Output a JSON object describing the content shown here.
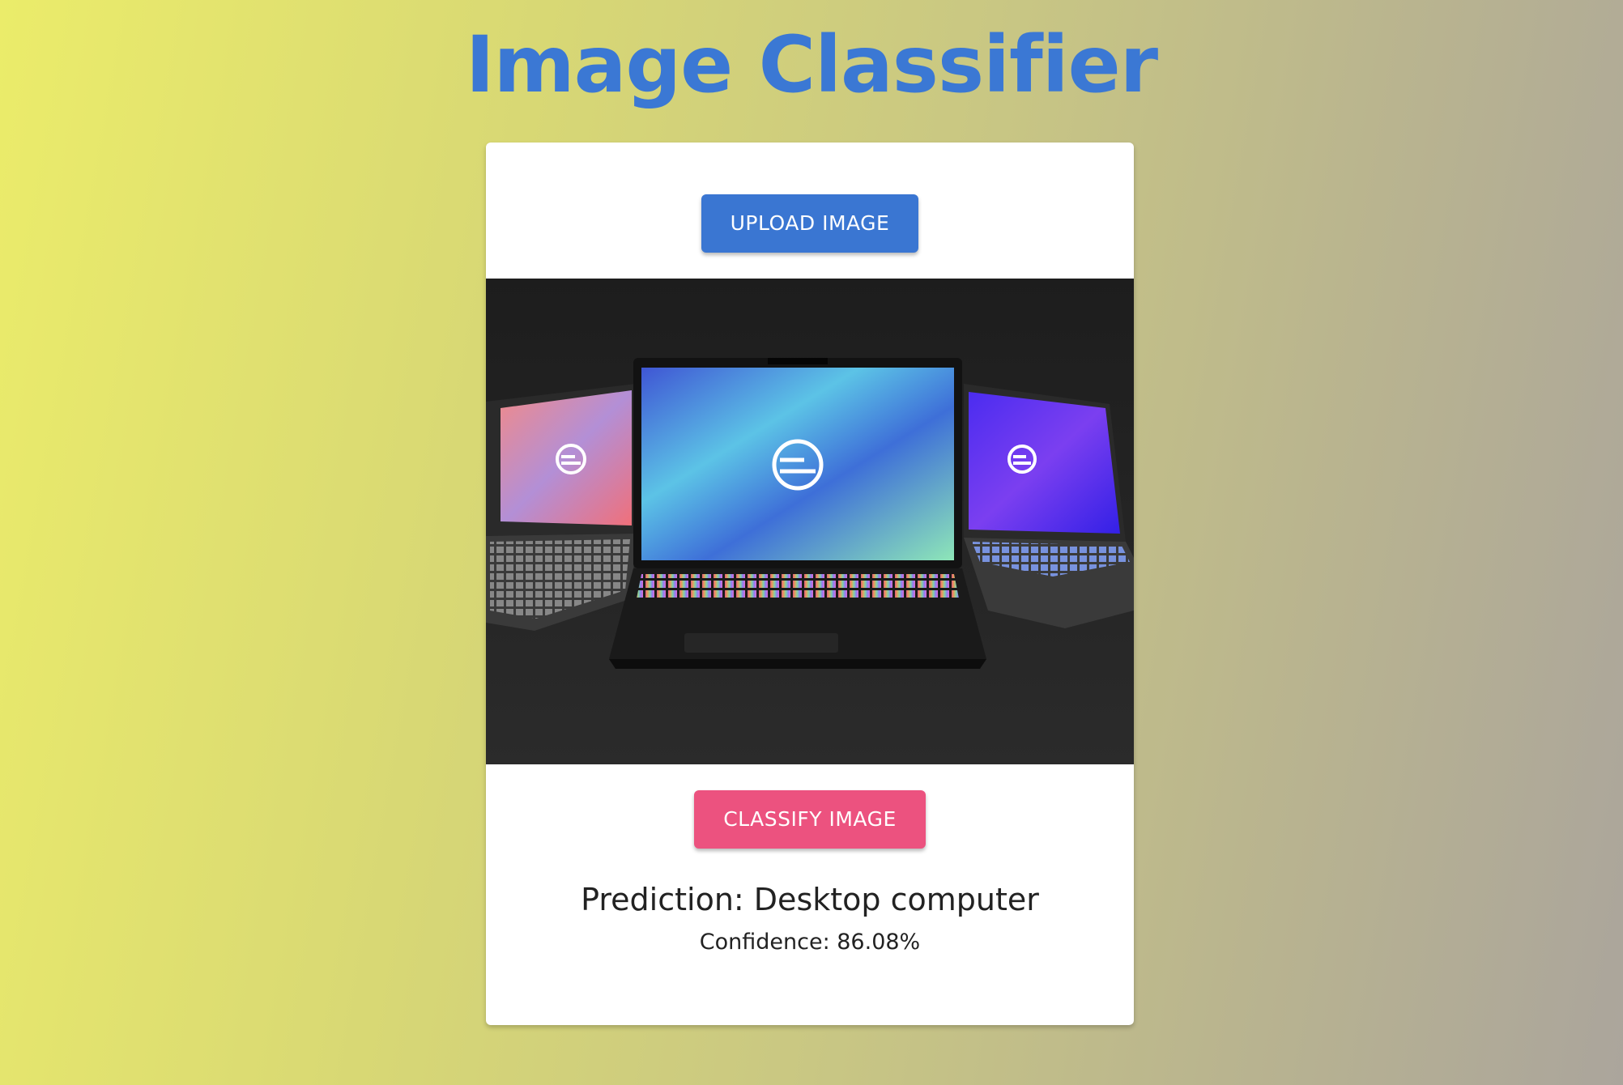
{
  "page": {
    "title": "Image Classifier",
    "background_colors": [
      "#ebec6a",
      "#aba59c"
    ],
    "title_color": "#3b78d4"
  },
  "card": {
    "upload_button": {
      "label": "UPLOAD IMAGE",
      "color": "#3a76d2"
    },
    "preview_image": {
      "subject": "three laptops with colorful screens and RGB keyboards on dark background",
      "background_color": "#212121"
    },
    "classify_button": {
      "label": "CLASSIFY IMAGE",
      "color": "#ec527f"
    },
    "result": {
      "prediction": "Prediction: Desktop computer",
      "confidence": "Confidence: 86.08%"
    }
  }
}
